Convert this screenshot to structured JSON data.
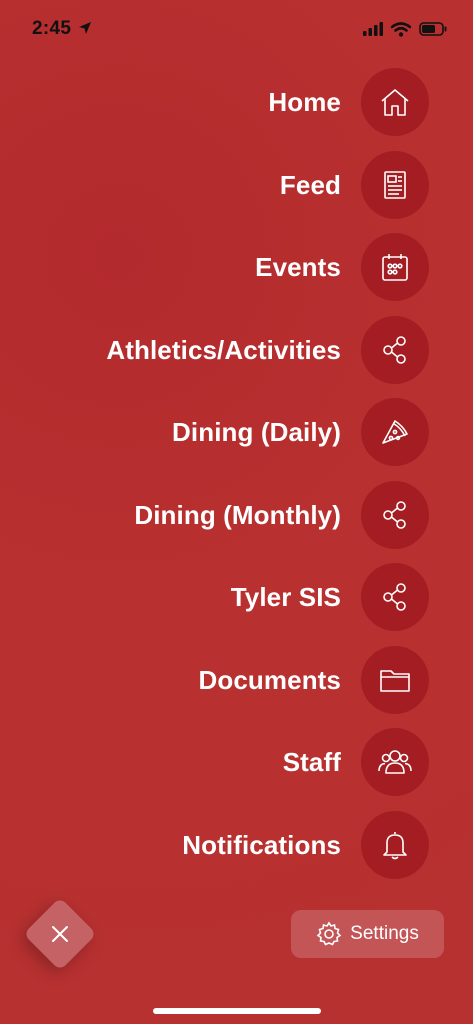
{
  "status_bar": {
    "time": "2:45"
  },
  "menu": {
    "items": [
      {
        "label": "Home",
        "icon": "home-icon"
      },
      {
        "label": "Feed",
        "icon": "newspaper-icon"
      },
      {
        "label": "Events",
        "icon": "calendar-icon"
      },
      {
        "label": "Athletics/Activities",
        "icon": "share-icon"
      },
      {
        "label": "Dining (Daily)",
        "icon": "pizza-icon"
      },
      {
        "label": "Dining (Monthly)",
        "icon": "share-icon"
      },
      {
        "label": "Tyler SIS",
        "icon": "share-icon"
      },
      {
        "label": "Documents",
        "icon": "folder-icon"
      },
      {
        "label": "Staff",
        "icon": "people-icon"
      },
      {
        "label": "Notifications",
        "icon": "bell-icon"
      }
    ]
  },
  "footer": {
    "close_icon": "close-icon",
    "settings_label": "Settings"
  },
  "colors": {
    "background": "#b8302f",
    "icon_circle": "#a41d22",
    "settings_button": "#c45557",
    "close_button": "#c46265"
  }
}
